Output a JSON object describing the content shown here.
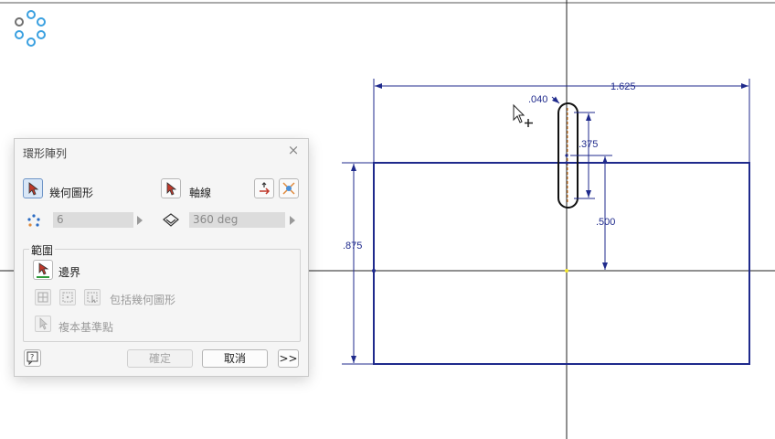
{
  "canvas": {
    "dimensions": {
      "width": "1.625",
      "height": ".875",
      "slot_width": ".040",
      "slot_length": ".375",
      "slot_offset": ".500"
    },
    "colors": {
      "sketch": "#1f2a8c",
      "axis": "#000000",
      "centerline": "#e07b17",
      "center_point": "#f1e32b"
    }
  },
  "view_cube_icon": "orbit-circles-icon",
  "dialog": {
    "title": "環形陣列",
    "geometry_label": "幾何圖形",
    "axis_label": "軸線",
    "count_value": "6",
    "angle_value": "360 deg",
    "range_group": "範圍",
    "boundary_label": "邊界",
    "include_geometry_label": "包括幾何圖形",
    "copy_datum_label": "複本基準點",
    "ok_label": "確定",
    "cancel_label": "取消",
    "more_label": ">>",
    "close_label": "×"
  }
}
